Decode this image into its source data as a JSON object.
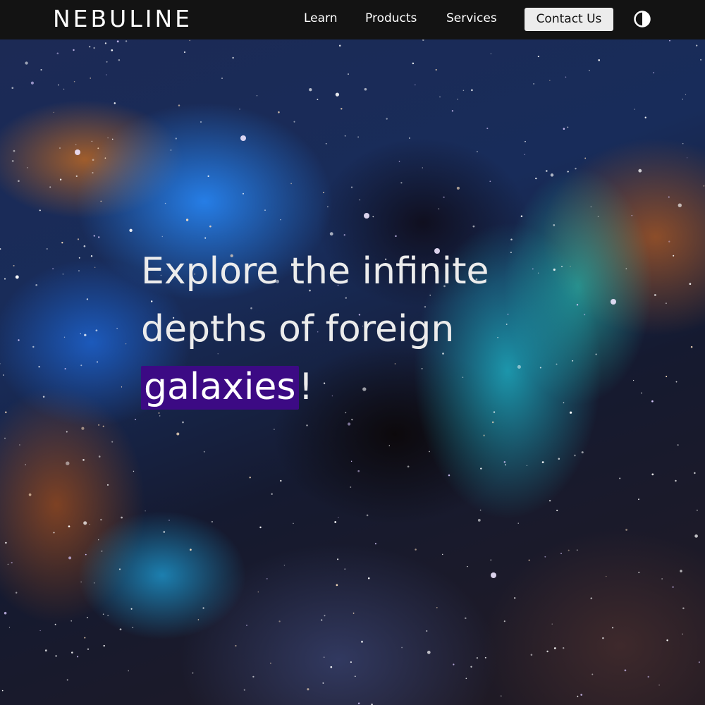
{
  "navbar": {
    "logo": "NEBULINE",
    "links": [
      {
        "label": "Learn"
      },
      {
        "label": "Products"
      },
      {
        "label": "Services"
      }
    ],
    "contact_button": "Contact Us",
    "theme_toggle_icon": "half-circle-contrast-icon"
  },
  "hero": {
    "line1": "Explore the infinite",
    "line2": "depths of foreign",
    "highlight": "galaxies",
    "punctuation": "!"
  },
  "colors": {
    "navbar_bg": "#131313",
    "highlight_bg": "#3c0a84",
    "contact_button_bg": "#ececec",
    "hero_text": "#ececec"
  }
}
